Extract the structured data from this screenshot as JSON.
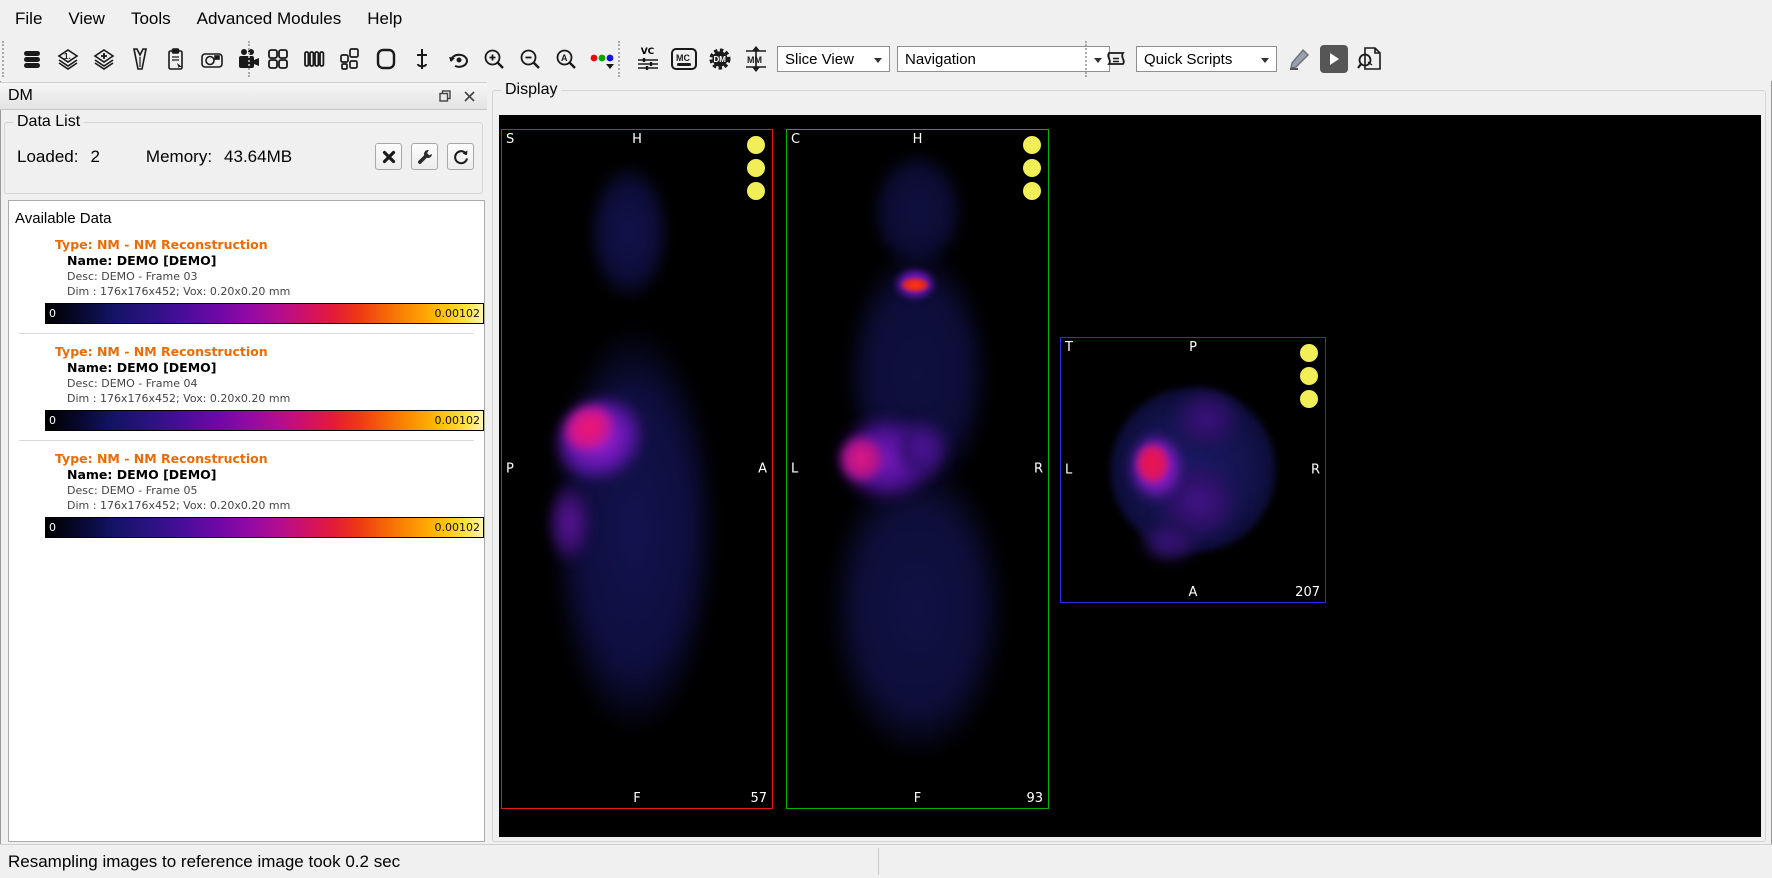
{
  "menu_bar": {
    "items": [
      "File",
      "View",
      "Tools",
      "Advanced Modules",
      "Help"
    ]
  },
  "toolbar": {
    "module_labels": {
      "vc": "VC",
      "mc": "MC",
      "dm": "DM",
      "mm": "MM"
    },
    "view_mode_select": "Slice View",
    "tool_select": "Navigation",
    "quick_scripts_select": "Quick Scripts"
  },
  "dm_panel": {
    "title": "DM",
    "group_label": "Data List",
    "loaded_label": "Loaded:",
    "loaded_value": "2",
    "memory_label": "Memory:",
    "memory_value": "43.64MB",
    "list_label": "Available Data",
    "type_color": "#ED6B06",
    "items": [
      {
        "type": "Type: NM - NM Reconstruction",
        "name": "Name: DEMO [DEMO]",
        "desc": "Desc: DEMO - Frame 03",
        "dim": "Dim : 176x176x452; Vox: 0.20x0.20 mm",
        "scale_min": "0",
        "scale_max": "0.00102"
      },
      {
        "type": "Type: NM - NM Reconstruction",
        "name": "Name: DEMO [DEMO]",
        "desc": "Desc: DEMO - Frame 04",
        "dim": "Dim : 176x176x452; Vox: 0.20x0.20 mm",
        "scale_min": "0",
        "scale_max": "0.00102"
      },
      {
        "type": "Type: NM - NM Reconstruction",
        "name": "Name: DEMO [DEMO]",
        "desc": "Desc: DEMO - Frame 05",
        "dim": "Dim : 176x176x452; Vox: 0.20x0.20 mm",
        "scale_min": "0",
        "scale_max": "0.00102"
      }
    ]
  },
  "display_panel": {
    "group_label": "Display",
    "marker_color": "#f1ee58",
    "views": [
      {
        "id": "sagittal",
        "border_color": "#e81717",
        "label_top_left": "S",
        "label_top_center": "H",
        "label_left": "P",
        "label_right": "A",
        "label_bottom_center": "F",
        "slice_number": "57"
      },
      {
        "id": "coronal",
        "border_color": "#00b400",
        "label_top_left": "C",
        "label_top_center": "H",
        "label_left": "L",
        "label_right": "R",
        "label_bottom_center": "F",
        "slice_number": "93"
      },
      {
        "id": "transverse",
        "border_color": "#2a2af0",
        "label_top_left": "T",
        "label_top_center": "P",
        "label_left": "L",
        "label_right": "R",
        "label_bottom_center": "A",
        "slice_number": "207"
      }
    ]
  },
  "status_bar": {
    "message": "Resampling images to reference image took 0.2 sec"
  }
}
